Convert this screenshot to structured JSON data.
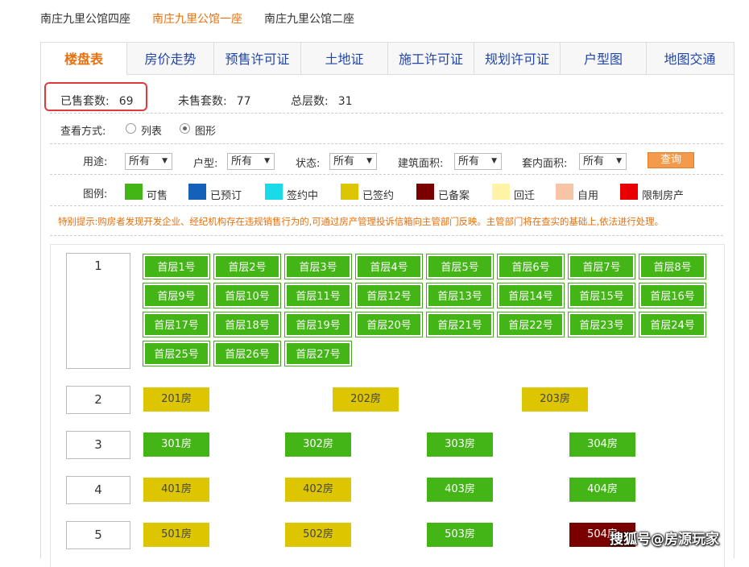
{
  "building_tabs": [
    "南庄九里公馆四座",
    "南庄九里公馆一座",
    "南庄九里公馆二座"
  ],
  "tabs": [
    "楼盘表",
    "房价走势",
    "预售许可证",
    "土地证",
    "施工许可证",
    "规划许可证",
    "户型图",
    "地图交通"
  ],
  "stats": {
    "sold_label": "已售套数:",
    "sold": "69",
    "unsold_label": "未售套数:",
    "unsold": "77",
    "floors_label": "总层数:",
    "floors": "31"
  },
  "view": {
    "label": "查看方式:",
    "list": "列表",
    "graphic": "图形",
    "selected": "图形"
  },
  "filters": {
    "usage_label": "用途:",
    "usage": "所有",
    "type_label": "户型:",
    "type": "所有",
    "status_label": "状态:",
    "status": "所有",
    "area_label": "建筑面积:",
    "area": "所有",
    "inner_label": "套内面积:",
    "inner": "所有",
    "query": "查询"
  },
  "legend": {
    "label": "图例:",
    "items": [
      {
        "name": "可售",
        "color": "#44b516"
      },
      {
        "name": "已预订",
        "color": "#1560b8"
      },
      {
        "name": "签约中",
        "color": "#19dbe8"
      },
      {
        "name": "已签约",
        "color": "#ddc500"
      },
      {
        "name": "已备案",
        "color": "#7a0000"
      },
      {
        "name": "回迁",
        "color": "#fff3a6"
      },
      {
        "name": "自用",
        "color": "#f7c4a6"
      },
      {
        "name": "限制房产",
        "color": "#e80000"
      }
    ]
  },
  "notice": "特别提示:购房者发现开发企业、经纪机构存在违规销售行为的,可通过房产管理投诉信箱向主管部门反映。主管部门将在查实的基础上,依法进行处理。",
  "floors": [
    {
      "num": "1",
      "units": [
        "首层1号",
        "首层2号",
        "首层3号",
        "首层4号",
        "首层5号",
        "首层6号",
        "首层7号",
        "首层8号",
        "首层9号",
        "首层10号",
        "首层11号",
        "首层12号",
        "首层13号",
        "首层14号",
        "首层15号",
        "首层16号",
        "首层17号",
        "首层18号",
        "首层19号",
        "首层20号",
        "首层21号",
        "首层22号",
        "首层23号",
        "首层24号",
        "首层25号",
        "首层26号",
        "首层27号"
      ]
    },
    {
      "num": "2",
      "units": [
        {
          "label": "201房",
          "status": "yellow"
        },
        {
          "label": "202房",
          "status": "yellow"
        },
        {
          "label": "203房",
          "status": "yellow"
        }
      ]
    },
    {
      "num": "3",
      "units": [
        {
          "label": "301房",
          "status": "green"
        },
        {
          "label": "302房",
          "status": "green"
        },
        {
          "label": "303房",
          "status": "green"
        },
        {
          "label": "304房",
          "status": "green"
        }
      ]
    },
    {
      "num": "4",
      "units": [
        {
          "label": "401房",
          "status": "yellow"
        },
        {
          "label": "402房",
          "status": "yellow"
        },
        {
          "label": "403房",
          "status": "green"
        },
        {
          "label": "404房",
          "status": "green"
        }
      ]
    },
    {
      "num": "5",
      "units": [
        {
          "label": "501房",
          "status": "yellow"
        },
        {
          "label": "502房",
          "status": "yellow"
        },
        {
          "label": "503房",
          "status": "green"
        },
        {
          "label": "504房",
          "status": "maroon"
        }
      ]
    }
  ],
  "watermark": "搜狐号@房源玩家"
}
